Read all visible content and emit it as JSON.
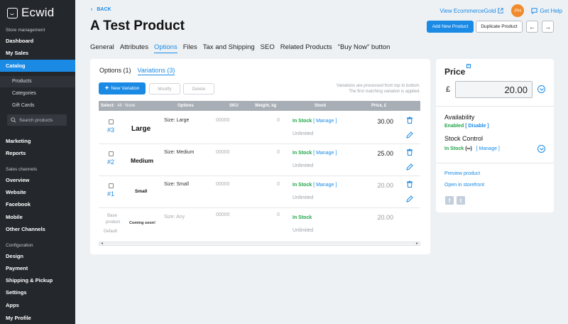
{
  "app": {
    "name": "Ecwid"
  },
  "sidebar": {
    "sections": [
      "Store management",
      "Sales channels",
      "Configuration"
    ],
    "items": {
      "dashboard": "Dashboard",
      "my_sales": "My Sales",
      "catalog": "Catalog",
      "products": "Products",
      "categories": "Categories",
      "gift_cards": "Gift Cards",
      "search_placeholder": "Search products",
      "marketing": "Marketing",
      "reports": "Reports",
      "overview": "Overview",
      "website": "Website",
      "facebook": "Facebook",
      "mobile": "Mobile",
      "other_channels": "Other Channels",
      "design": "Design",
      "payment": "Payment",
      "shipping": "Shipping & Pickup",
      "settings": "Settings",
      "apps": "Apps",
      "my_profile": "My Profile"
    }
  },
  "header": {
    "back": "BACK",
    "title": "A Test Product",
    "view_link": "View EcommerceGold",
    "avatar": "PH",
    "help": "Get Help",
    "add_new": "Add New Product",
    "duplicate": "Duplicate Product"
  },
  "tabs": [
    "General",
    "Attributes",
    "Options",
    "Files",
    "Tax and Shipping",
    "SEO",
    "Related Products",
    "\"Buy Now\" button"
  ],
  "variations": {
    "subtabs": [
      "Options (1)",
      "Variations (3)"
    ],
    "new_variation": "New Variation",
    "modify": "Modify",
    "delete": "Delete",
    "note": "Variations are processed from top to bottom. The first matching variation is applied.",
    "headers": {
      "select": "Select:",
      "all": "All",
      "none": "None",
      "options": "Options",
      "sku": "SKU",
      "weight": "Weight, kg",
      "stock": "Stock",
      "price": "Price, £"
    },
    "rows": [
      {
        "num": "#3",
        "label": "Large",
        "option": "Size: Large",
        "sku": "00000",
        "weight": "0",
        "stock": "In Stock",
        "manage": "[ Manage ]",
        "qty": "Unlimited",
        "price": "30.00"
      },
      {
        "num": "#2",
        "label": "Medium",
        "option": "Size: Medium",
        "sku": "00000",
        "weight": "0",
        "stock": "In Stock",
        "manage": "[ Manage ]",
        "qty": "Unlimited",
        "price": "25.00"
      },
      {
        "num": "#1",
        "label": "Small",
        "option": "Size: Small",
        "sku": "00000",
        "weight": "0",
        "stock": "In Stock",
        "manage": "[ Manage ]",
        "qty": "Unlimited",
        "price": "20.00"
      }
    ],
    "base": {
      "label1": "Base",
      "label2": "product",
      "label3": "Default",
      "image_text": "Coming soon!",
      "option": "Size: Any",
      "sku": "00000",
      "weight": "0",
      "stock": "In Stock",
      "qty": "Unlimited",
      "price": "20.00"
    }
  },
  "price_panel": {
    "title": "Price",
    "currency": "£",
    "value": "20.00",
    "availability_label": "Availability",
    "enabled": "Enabled",
    "disable": "[ Disable ]",
    "stock_control": "Stock Control",
    "in_stock": "In Stock",
    "infinity": "(∞)",
    "manage": "[ Manage ]",
    "preview": "Preview product",
    "storefront": "Open in storefront",
    "facebook": "f",
    "twitter": "t"
  },
  "colors": {
    "accent": "#1a8ae5",
    "sidebar": "#24272c",
    "green": "#22a54a"
  }
}
